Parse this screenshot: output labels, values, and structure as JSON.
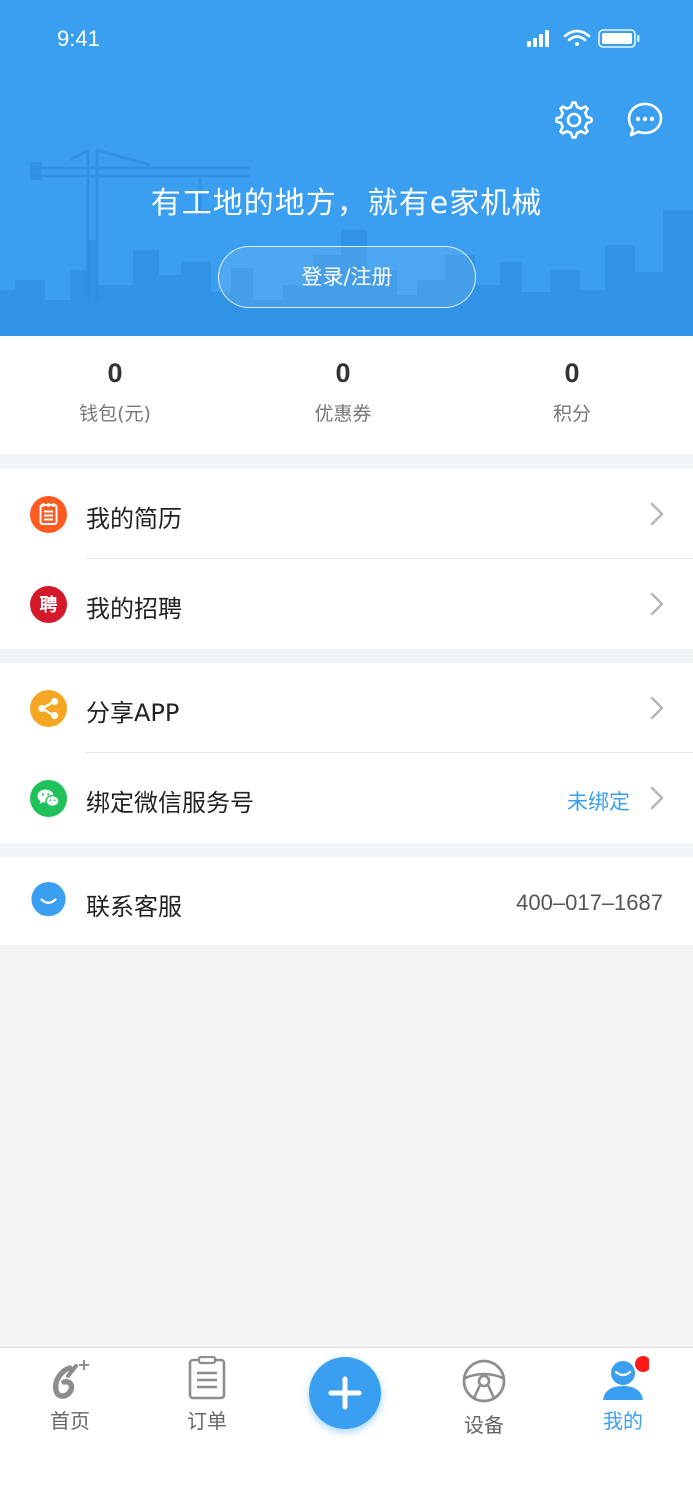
{
  "status_bar": {
    "time": "9:41"
  },
  "header": {
    "slogan": "有工地的地方，就有e家机械",
    "login_label": "登录/注册",
    "settings_icon": "gear-icon",
    "message_icon": "chat-bubble-icon"
  },
  "stats": [
    {
      "value": "0",
      "label": "钱包(元)"
    },
    {
      "value": "0",
      "label": "优惠券"
    },
    {
      "value": "0",
      "label": "积分"
    }
  ],
  "menu": {
    "resume": {
      "label": "我的简历",
      "icon": "resume-icon"
    },
    "recruit": {
      "label": "我的招聘",
      "icon": "recruit-icon",
      "icon_text": "聘"
    },
    "share": {
      "label": "分享APP",
      "icon": "share-icon"
    },
    "wechat": {
      "label": "绑定微信服务号",
      "value": "未绑定",
      "icon": "wechat-icon"
    },
    "service": {
      "label": "联系客服",
      "phone": "400–017–1687",
      "icon": "customer-service-icon"
    }
  },
  "tabbar": {
    "home": "首页",
    "orders": "订单",
    "add_icon": "plus-icon",
    "equipment": "设备",
    "mine": "我的"
  },
  "colors": {
    "primary": "#3a9ff0",
    "background": "#f3f4f6",
    "badge": "#ff1a1a"
  }
}
